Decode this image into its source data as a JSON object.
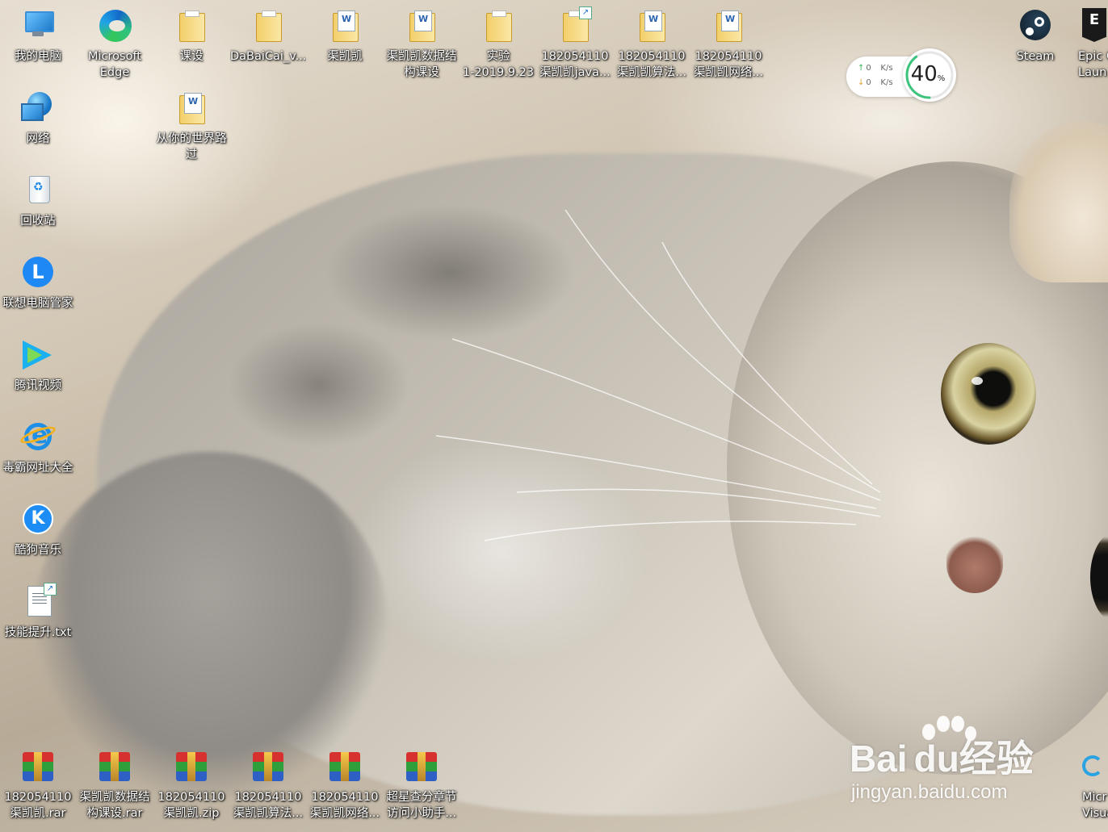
{
  "desktop": {
    "icons_top_row": [
      {
        "label": "我的电脑",
        "line2": "",
        "icon": "computer-icon"
      },
      {
        "label": "Microsoft",
        "line2": "Edge",
        "icon": "edge-icon"
      },
      {
        "label": "课设",
        "line2": "",
        "icon": "folder-icon"
      },
      {
        "label": "DaBaiCai_v...",
        "line2": "",
        "icon": "folder-icon"
      },
      {
        "label": "渠凯凯",
        "line2": "",
        "icon": "word-folder-icon"
      },
      {
        "label": "渠凯凯数据结",
        "line2": "构课设",
        "icon": "word-folder-icon"
      },
      {
        "label": "实验",
        "line2": "1-2019.9.23",
        "icon": "folder-icon"
      },
      {
        "label": "182054110",
        "line2": "渠凯凯java...",
        "icon": "shortcut-folder-icon"
      },
      {
        "label": "182054110",
        "line2": "渠凯凯算法...",
        "icon": "word-folder-icon"
      },
      {
        "label": "182054110",
        "line2": "渠凯凯网络...",
        "icon": "word-folder-icon"
      }
    ],
    "icons_left_column": [
      {
        "label": "网络",
        "line2": "",
        "icon": "network-icon"
      },
      {
        "label": "回收站",
        "line2": "",
        "icon": "recycle-bin-icon"
      },
      {
        "label": "联想电脑管家",
        "line2": "",
        "icon": "lenovo-icon"
      },
      {
        "label": "腾讯视频",
        "line2": "",
        "icon": "tencent-video-icon"
      },
      {
        "label": "毒霸网址大全",
        "line2": "",
        "icon": "ie-icon"
      },
      {
        "label": "酷狗音乐",
        "line2": "",
        "icon": "kugou-icon"
      },
      {
        "label": "技能提升.txt",
        "line2": "",
        "icon": "text-file-icon"
      }
    ],
    "icon_folder_second": {
      "label": "从你的世界路",
      "line2": "过",
      "icon": "word-folder-icon"
    },
    "icons_bottom_row": [
      {
        "label": "182054110",
        "line2": "渠凯凯.rar",
        "icon": "winrar-icon"
      },
      {
        "label": "渠凯凯数据结",
        "line2": "构课设.rar",
        "icon": "winrar-icon"
      },
      {
        "label": "182054110",
        "line2": "渠凯凯.zip",
        "icon": "winrar-icon"
      },
      {
        "label": "182054110",
        "line2": "渠凯凯算法...",
        "icon": "winrar-icon"
      },
      {
        "label": "182054110",
        "line2": "渠凯凯网络...",
        "icon": "winrar-icon"
      },
      {
        "label": "超星查分章节",
        "line2": "访问小助手...",
        "icon": "winrar-icon"
      }
    ],
    "icons_right": [
      {
        "label": "Steam",
        "line2": "",
        "icon": "steam-icon"
      },
      {
        "label": "Epic G",
        "line2": "Laun",
        "icon": "epic-games-icon"
      }
    ],
    "icon_bottom_right": {
      "label": "Micr",
      "line2": "Visua",
      "icon": "visual-studio-icon"
    }
  },
  "net_widget": {
    "upload_value": "0",
    "upload_unit": "K/s",
    "download_value": "0",
    "download_unit": "K/s",
    "usage_percent": "40",
    "usage_suffix": "%",
    "usage_fraction": 0.4,
    "ring_color": "#3cc47c"
  },
  "watermark": {
    "brand_left": "Bai",
    "brand_mid": "du",
    "brand_right": "经验",
    "url": "jingyan.baidu.com"
  }
}
